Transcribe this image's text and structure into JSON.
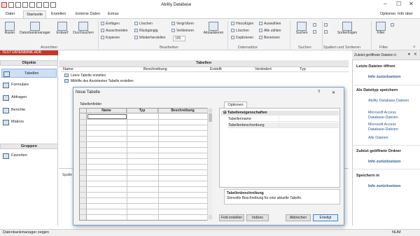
{
  "app": {
    "title": "Ability Database",
    "window_buttons": [
      "–",
      "☐",
      "✕"
    ]
  },
  "ribbon": {
    "tabs": [
      "Datei",
      "Startseite",
      "Erstellen",
      "Externe Daten",
      "Extras"
    ],
    "right": {
      "options": "Optionen",
      "info": "Info über"
    },
    "groups": {
      "views": "Ansichten",
      "edit": "Bearbeiten",
      "records": "Datensätze",
      "search": "Suchen",
      "columns": "Spalten und Sortieren",
      "filter": "Filter"
    },
    "buttons": {
      "raster": "Raster",
      "dbmanager": "Datenbankmanager",
      "design": "Entwurf",
      "browse": "Durchsuchen",
      "insert": "Einfügen",
      "cut": "Ausschneiden",
      "copy": "Kopieren",
      "delete_edit": "Löschen",
      "undo": "Rückgängig",
      "redo": "Wiederherstellen",
      "enlarge": "Vergrößern",
      "shrink": "Verkleinern",
      "zoom": "100",
      "refresh": "Aktualisieren",
      "add": "Hinzufügen",
      "delete_rec": "Löschen",
      "duplicate": "Duplizieren",
      "select": "Auswählen",
      "select_all": "Alle zählen",
      "rename": "Benennen",
      "search": "Suchen",
      "sort": "Sortierfolgen",
      "filter": "Filter"
    }
  },
  "nav": {
    "db_name": "TEST DATENBANK.ADB",
    "objects_header": "Objekte",
    "items": [
      "Tabellen",
      "Formulare",
      "Abfragen",
      "Berichte",
      "Makros"
    ],
    "groups_header": "Gruppen",
    "groups": [
      "Favoriten"
    ]
  },
  "main": {
    "header": "Tabellen",
    "columns": [
      "Name",
      "Beschreibung",
      "Erstellt",
      "Verändert",
      "Typ"
    ],
    "rows": [
      "Leere Tabelle erstellen",
      "Mithilfe des Assistenten Tabelle erstellen"
    ],
    "bottom_label": "Spalte"
  },
  "pane": {
    "title": "Zuletzt geöffnete Dateien ö",
    "controls": [
      "▾",
      "✕"
    ],
    "open_recent": {
      "heading": "Letzte Dateien öffnen",
      "link": "Info zurücksetzen"
    },
    "save_as": {
      "heading": "Als Dateityp speichern",
      "links": [
        "Ability Database-Dateien",
        "Microsoft Access Database-Dateien",
        "Microsoft Access Database-Dateien",
        "Alle Dateien"
      ]
    },
    "recent_folders": {
      "heading": "Zuletzt geöffnete Ordner",
      "link": "Info zurücksetzen"
    },
    "save_in": {
      "heading": "Speichern in",
      "link": "Info zurücksetzen"
    }
  },
  "dialog": {
    "title": "Neue Tabelle",
    "help": "?",
    "close": "✕",
    "fields_label": "Tabellenfelder",
    "grid_headers": [
      "Name",
      "Typ",
      "Beschreibung"
    ],
    "options_tab": "Optionen",
    "properties_section": "Tabelleneigenschaften",
    "properties": [
      "Tabellenname",
      "Tabellenbeschreibung"
    ],
    "desc_title": "Tabellenbeschreibung",
    "desc_text": "Sinnvolle Beschreibung für eine aktuelle Tabelle.",
    "buttons": {
      "field_create": "Feld erstellen",
      "index": "Indizes",
      "cancel": "Abbrechen",
      "done": "Erledigt"
    }
  },
  "status": {
    "left": "Datenbankmanager zeigen",
    "right": "NUM"
  }
}
